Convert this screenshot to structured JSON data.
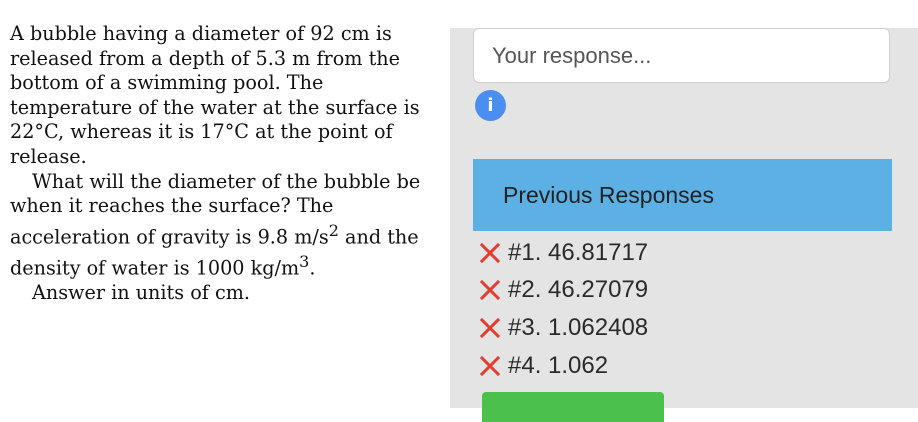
{
  "problem": {
    "paragraph1": "A bubble having a diameter of 92 cm is released from a depth of 5.3 m from the bottom of a swimming pool. The temperature of the water at the surface is 22°C, whereas it is 17°C at the point of release.",
    "paragraph2_before_ms": "What will the diameter of the bubble be when it reaches the surface? The acceleration of gravity is 9.8 m/s",
    "paragraph2_mid": " and the density of water is 1000 kg/m",
    "paragraph2_end": ".",
    "exp2": "2",
    "exp3": "3",
    "paragraph3": "Answer in units of  cm."
  },
  "response": {
    "placeholder": "Your response..."
  },
  "info_icon_glyph": "i",
  "previous_responses": {
    "header": "Previous Responses",
    "items": [
      {
        "label": "#1. 46.81717",
        "status": "incorrect"
      },
      {
        "label": "#2. 46.27079",
        "status": "incorrect"
      },
      {
        "label": "#3. 1.062408",
        "status": "incorrect"
      },
      {
        "label": "#4. 1.062",
        "status": "incorrect"
      }
    ]
  },
  "colors": {
    "header_bg": "#5db0e4",
    "incorrect_x": "#e43d30",
    "info_icon": "#4a8ff0",
    "submit_button": "#4cc04c"
  }
}
